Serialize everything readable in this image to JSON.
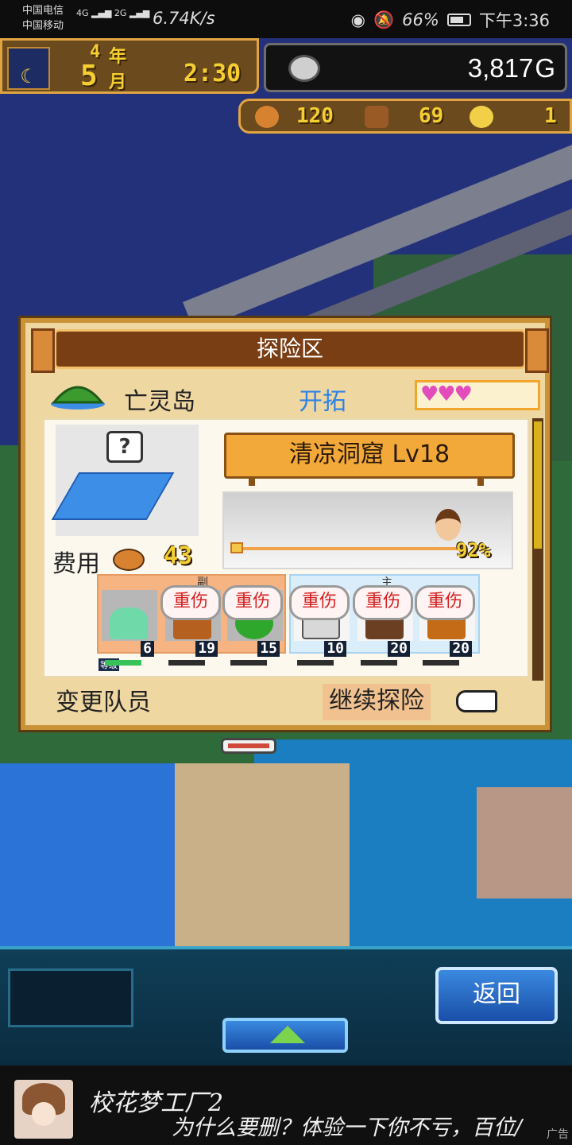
{
  "status_bar": {
    "carrier_1": "中国电信",
    "carrier_2": "中国移动",
    "network_1": "4G",
    "network_2": "2G",
    "speed": "6.74K/s",
    "battery": "66%",
    "time": "下午3:36"
  },
  "hud": {
    "year": "4",
    "year_unit": "年",
    "month": "5",
    "month_unit": "月",
    "clock": "2:30",
    "money": "3,817",
    "money_unit": "G",
    "food": "120",
    "wood": "69",
    "medal": "1"
  },
  "dialog": {
    "title": "探险区",
    "island_name": "亡灵岛",
    "action_label": "开拓",
    "hearts": "♥♥♥",
    "hearts_value": 3,
    "fee_label": "费用",
    "fee_value": "43",
    "dungeon": "清凉洞窟 Lv18",
    "progress_text": "92%",
    "progress_value": 0.92,
    "team_a_tag": "副",
    "team_b_tag": "主",
    "level_label": "等级",
    "members_a": [
      {
        "level": "6",
        "hurt": ""
      },
      {
        "level": "19",
        "hurt": "重伤"
      },
      {
        "level": "15",
        "hurt": "重伤"
      }
    ],
    "members_b": [
      {
        "level": "10",
        "hurt": "重伤"
      },
      {
        "level": "20",
        "hurt": "重伤"
      },
      {
        "level": "20",
        "hurt": "重伤"
      }
    ],
    "change_team": "变更队员",
    "continue": "继续探险"
  },
  "bottom": {
    "back": "返回"
  },
  "ad": {
    "title": "校花梦工厂2",
    "desc": "为什么要删？体验一下你不亏，百位/",
    "tag": "广告"
  },
  "colors": {
    "gold_text": "#f5cf32",
    "explore_blue": "#2d82e6",
    "hurt_red": "#d5201f",
    "heart_pink": "#e24dbb"
  }
}
